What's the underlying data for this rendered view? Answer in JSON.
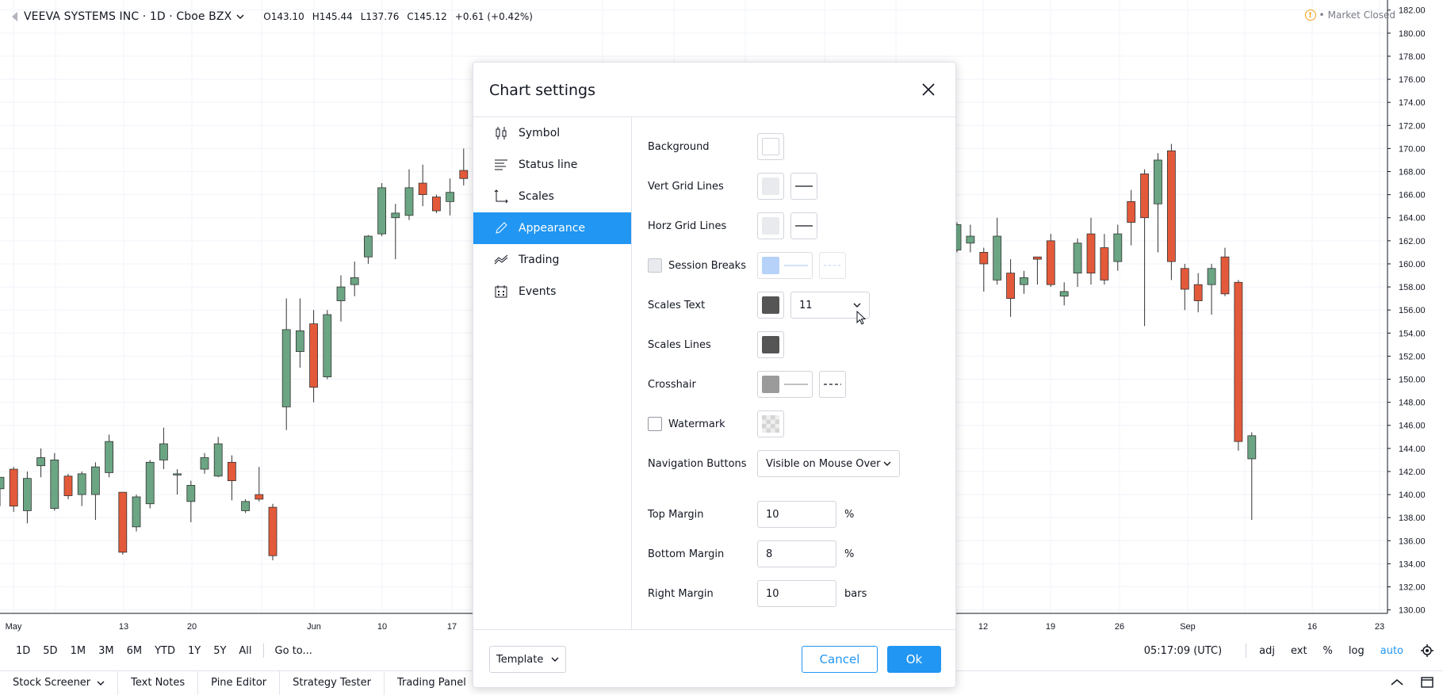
{
  "header": {
    "symbol": "VEEVA SYSTEMS INC · 1D · Cboe BZX",
    "open": "O143.10",
    "high": "H145.44",
    "low": "L137.76",
    "close": "C145.12",
    "change": "+0.61 (+0.42%)",
    "market_status": "Market Closed"
  },
  "colors": {
    "up": "#6ba583",
    "down": "#e35a3a",
    "accent": "#2196f3",
    "grid": "#f0f3fa"
  },
  "chart_data": {
    "type": "candlestick",
    "y_ticks": [
      "182.00",
      "180.00",
      "178.00",
      "176.00",
      "174.00",
      "172.00",
      "170.00",
      "168.00",
      "166.00",
      "164.00",
      "162.00",
      "160.00",
      "158.00",
      "156.00",
      "154.00",
      "152.00",
      "150.00",
      "148.00",
      "146.00",
      "144.00",
      "142.00",
      "140.00",
      "138.00",
      "136.00",
      "134.00",
      "132.00",
      "130.00"
    ],
    "ylim": [
      130,
      182
    ],
    "x_ticks_left": [
      "May",
      "13",
      "20",
      "Jun",
      "10",
      "17"
    ],
    "x_ticks_right": [
      "12",
      "19",
      "26",
      "Sep",
      "16",
      "23"
    ],
    "candles_left": [
      {
        "o": 140.5,
        "h": 141.5,
        "l": 139.0,
        "c": 141.5
      },
      {
        "o": 142.2,
        "h": 142.4,
        "l": 138.5,
        "c": 139.0
      },
      {
        "o": 138.6,
        "h": 142.0,
        "l": 137.5,
        "c": 141.4
      },
      {
        "o": 142.5,
        "h": 144.0,
        "l": 141.5,
        "c": 143.2
      },
      {
        "o": 138.8,
        "h": 143.6,
        "l": 138.6,
        "c": 143.0
      },
      {
        "o": 141.6,
        "h": 141.8,
        "l": 139.6,
        "c": 139.9
      },
      {
        "o": 140.0,
        "h": 142.0,
        "l": 139.0,
        "c": 141.8
      },
      {
        "o": 140.0,
        "h": 142.8,
        "l": 137.8,
        "c": 142.4
      },
      {
        "o": 141.9,
        "h": 145.2,
        "l": 141.5,
        "c": 144.6
      },
      {
        "o": 140.2,
        "h": 140.2,
        "l": 134.8,
        "c": 135.0
      },
      {
        "o": 137.2,
        "h": 140.0,
        "l": 136.8,
        "c": 139.8
      },
      {
        "o": 139.2,
        "h": 143.0,
        "l": 138.8,
        "c": 142.8
      },
      {
        "o": 143.0,
        "h": 145.8,
        "l": 142.2,
        "c": 144.4
      },
      {
        "o": 141.8,
        "h": 142.2,
        "l": 140.0,
        "c": 141.8
      },
      {
        "o": 139.4,
        "h": 141.2,
        "l": 137.6,
        "c": 140.8
      },
      {
        "o": 142.2,
        "h": 143.6,
        "l": 141.8,
        "c": 143.2
      },
      {
        "o": 141.6,
        "h": 145.0,
        "l": 141.5,
        "c": 144.4
      },
      {
        "o": 142.8,
        "h": 143.4,
        "l": 139.5,
        "c": 141.2
      },
      {
        "o": 138.6,
        "h": 139.6,
        "l": 138.4,
        "c": 139.4
      },
      {
        "o": 140.0,
        "h": 142.4,
        "l": 139.4,
        "c": 139.6
      },
      {
        "o": 138.9,
        "h": 139.2,
        "l": 134.3,
        "c": 134.7
      },
      {
        "o": 147.6,
        "h": 157.0,
        "l": 145.6,
        "c": 154.3
      },
      {
        "o": 152.4,
        "h": 157.0,
        "l": 151.0,
        "c": 154.2
      },
      {
        "o": 154.8,
        "h": 156.0,
        "l": 148.0,
        "c": 149.3
      },
      {
        "o": 150.2,
        "h": 156.0,
        "l": 150.0,
        "c": 155.6
      },
      {
        "o": 156.8,
        "h": 159.0,
        "l": 155.0,
        "c": 158.0
      },
      {
        "o": 158.2,
        "h": 160.2,
        "l": 157.2,
        "c": 158.8
      },
      {
        "o": 160.6,
        "h": 162.5,
        "l": 160.0,
        "c": 162.4
      },
      {
        "o": 162.6,
        "h": 167.0,
        "l": 162.4,
        "c": 166.6
      },
      {
        "o": 164.0,
        "h": 165.2,
        "l": 160.4,
        "c": 164.4
      },
      {
        "o": 164.2,
        "h": 168.2,
        "l": 163.8,
        "c": 166.6
      },
      {
        "o": 167.0,
        "h": 168.6,
        "l": 165.0,
        "c": 166.0
      },
      {
        "o": 165.8,
        "h": 166.0,
        "l": 164.4,
        "c": 164.6
      },
      {
        "o": 165.4,
        "h": 167.4,
        "l": 164.2,
        "c": 166.2
      },
      {
        "o": 168.1,
        "h": 170.0,
        "l": 166.8,
        "c": 167.4
      }
    ],
    "candles_right": [
      {
        "o": 161.2,
        "h": 163.6,
        "l": 161.0,
        "c": 163.4
      },
      {
        "o": 161.8,
        "h": 163.4,
        "l": 161.0,
        "c": 162.4
      },
      {
        "o": 161.0,
        "h": 161.4,
        "l": 157.6,
        "c": 160.0
      },
      {
        "o": 158.6,
        "h": 164.0,
        "l": 158.2,
        "c": 162.4
      },
      {
        "o": 159.2,
        "h": 160.4,
        "l": 155.4,
        "c": 157.0
      },
      {
        "o": 158.2,
        "h": 159.4,
        "l": 157.4,
        "c": 158.8
      },
      {
        "o": 160.6,
        "h": 160.6,
        "l": 158.2,
        "c": 160.4
      },
      {
        "o": 162.0,
        "h": 162.6,
        "l": 158.0,
        "c": 158.2
      },
      {
        "o": 157.2,
        "h": 158.4,
        "l": 156.4,
        "c": 157.6
      },
      {
        "o": 159.2,
        "h": 162.2,
        "l": 158.0,
        "c": 161.8
      },
      {
        "o": 162.6,
        "h": 164.0,
        "l": 158.2,
        "c": 159.2
      },
      {
        "o": 161.4,
        "h": 162.6,
        "l": 158.2,
        "c": 158.6
      },
      {
        "o": 160.2,
        "h": 163.4,
        "l": 159.4,
        "c": 162.6
      },
      {
        "o": 165.4,
        "h": 166.4,
        "l": 161.6,
        "c": 163.6
      },
      {
        "o": 167.8,
        "h": 168.2,
        "l": 154.6,
        "c": 164.0
      },
      {
        "o": 165.2,
        "h": 169.6,
        "l": 161.0,
        "c": 169.0
      },
      {
        "o": 169.8,
        "h": 170.4,
        "l": 158.6,
        "c": 160.2
      },
      {
        "o": 159.6,
        "h": 160.0,
        "l": 156.0,
        "c": 157.8
      },
      {
        "o": 158.2,
        "h": 159.2,
        "l": 155.8,
        "c": 156.8
      },
      {
        "o": 158.2,
        "h": 160.0,
        "l": 155.6,
        "c": 159.6
      },
      {
        "o": 160.6,
        "h": 161.4,
        "l": 157.2,
        "c": 157.4
      },
      {
        "o": 158.4,
        "h": 158.6,
        "l": 143.8,
        "c": 144.6
      },
      {
        "o": 143.1,
        "h": 145.4,
        "l": 137.8,
        "c": 145.1
      }
    ]
  },
  "bottom_toolbar": {
    "ranges": [
      "1D",
      "5D",
      "1M",
      "3M",
      "6M",
      "YTD",
      "1Y",
      "5Y",
      "All"
    ],
    "goto": "Go to...",
    "time": "05:17:09 (UTC)",
    "adj": "adj",
    "ext": "ext",
    "pct": "%",
    "log": "log",
    "auto": "auto"
  },
  "bottom_tabs": [
    "Stock Screener",
    "Text Notes",
    "Pine Editor",
    "Strategy Tester",
    "Trading Panel"
  ],
  "dialog": {
    "title": "Chart settings",
    "sidebar": [
      {
        "label": "Symbol",
        "icon": "candlestick-icon"
      },
      {
        "label": "Status line",
        "icon": "status-line-icon"
      },
      {
        "label": "Scales",
        "icon": "scales-icon"
      },
      {
        "label": "Appearance",
        "icon": "brush-icon"
      },
      {
        "label": "Trading",
        "icon": "trading-icon"
      },
      {
        "label": "Events",
        "icon": "calendar-icon"
      }
    ],
    "active_tab": "Appearance",
    "fields": {
      "background": "Background",
      "vert_grid": "Vert Grid Lines",
      "horz_grid": "Horz Grid Lines",
      "session_breaks": "Session Breaks",
      "scales_text": "Scales Text",
      "scales_text_size": "11",
      "scales_lines": "Scales Lines",
      "crosshair": "Crosshair",
      "watermark": "Watermark",
      "nav_buttons": "Navigation Buttons",
      "nav_buttons_value": "Visible on Mouse Over",
      "top_margin": "Top Margin",
      "top_margin_value": "10",
      "bottom_margin": "Bottom Margin",
      "bottom_margin_value": "8",
      "right_margin": "Right Margin",
      "right_margin_value": "10",
      "pct_unit": "%",
      "bars_unit": "bars"
    },
    "swatch_colors": {
      "background": "#ffffff",
      "vert_grid": "#e9eaee",
      "horz_grid": "#e9eaee",
      "session_breaks": "#9fc3f7",
      "scales_text": "#555555",
      "scales_lines": "#555555",
      "crosshair": "#9b9b9b"
    },
    "template_label": "Template",
    "cancel_label": "Cancel",
    "ok_label": "Ok"
  }
}
